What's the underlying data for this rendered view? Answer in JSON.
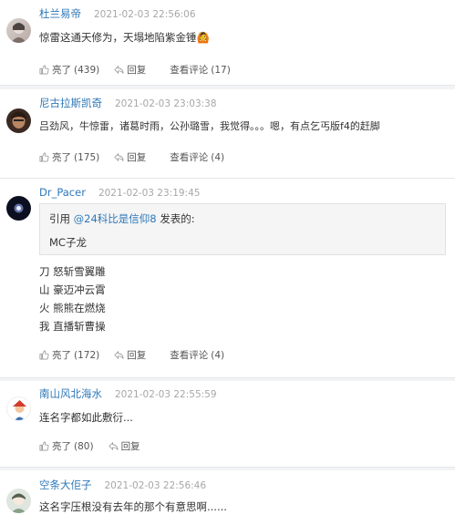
{
  "labels": {
    "like": "亮了",
    "reply": "回复",
    "view_reply": "查看评论"
  },
  "comments": [
    {
      "user": "杜兰易帝",
      "time": "2021-02-03 22:56:06",
      "text": "惊雷这通天修为，天塌地陷紫金锤",
      "emoji": "🙆",
      "likes": "(439)",
      "reply_count": "(17)"
    },
    {
      "user": "尼古拉斯凯奇",
      "time": "2021-02-03 23:03:38",
      "text": "吕劲风，牛惊雷，诸葛时雨，公孙璐雪，我觉得。。。嗯，有点乞丐版f4的赶脚",
      "likes": "(175)",
      "reply_count": "(4)"
    },
    {
      "user": "Dr_Pacer",
      "time": "2021-02-03 23:19:45",
      "quote_prefix": "引用 ",
      "quote_user": "@24科比是信仰8",
      "quote_suffix": " 发表的:",
      "quote_text": "MC子龙",
      "lines": [
        "刀 怒斩雪翼雕",
        "山 豪迈冲云霄",
        "火 熊熊在燃烧",
        "我 直播斩曹操"
      ],
      "likes": "(172)",
      "reply_count": "(4)"
    },
    {
      "user": "南山风北海水",
      "time": "2021-02-03 22:55:59",
      "text": "连名字都如此敷衍...",
      "likes": "(80)"
    },
    {
      "user": "空条大佢子",
      "time": "2021-02-03 22:56:46",
      "text": "这名字压根没有去年的那个有意思啊......"
    }
  ],
  "colors": {
    "link": "#2f78b7",
    "time": "#a7a7a7",
    "bg": "#f2f3f5"
  }
}
